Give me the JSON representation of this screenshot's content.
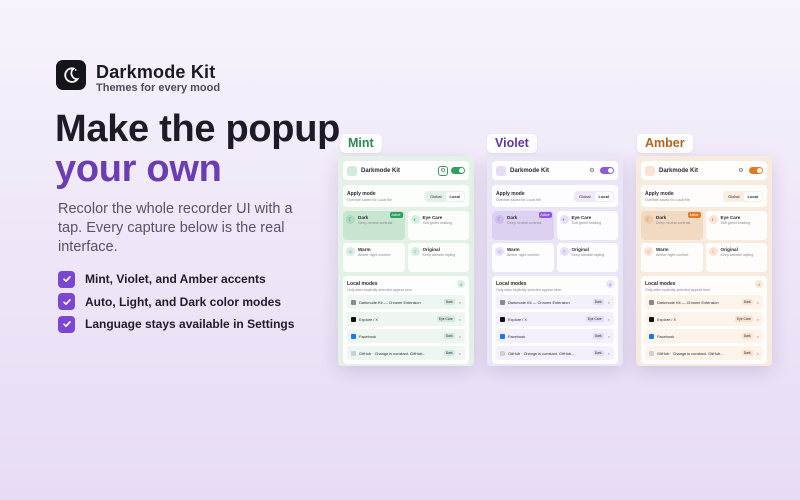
{
  "brand": {
    "name": "Darkmode Kit",
    "tagline": "Themes for every mood"
  },
  "hero": {
    "headline_line1": "Make the popup",
    "headline_line2": "your own",
    "lead": "Recolor the whole recorder UI with a tap. Every capture below is the real interface.",
    "features": [
      "Mint, Violet, and Amber accents",
      "Auto, Light, and Dark color modes",
      "Language stays available in Settings"
    ],
    "accent_color": "#6a3db4",
    "check_color": "#7b47d2"
  },
  "popup": {
    "title": "Darkmode Kit",
    "apply_title": "Apply mode",
    "apply_sub": "Override saved for Local file",
    "segment_global": "Global",
    "segment_local": "Local",
    "tiles": [
      {
        "name": "Dark",
        "desc": "Deep neutral contrast",
        "badge": "Active"
      },
      {
        "name": "Eye Care",
        "desc": "Soft green reading",
        "badge": ""
      },
      {
        "name": "Warm",
        "desc": "Amber night comfort",
        "badge": ""
      },
      {
        "name": "Original",
        "desc": "Keep website styling",
        "badge": ""
      }
    ],
    "local_title": "Local modes",
    "local_sub": "Only sites explicitly selected appear here",
    "local_count": "4",
    "sites": [
      {
        "name": "Darkmode Kit — Chrome Extension",
        "mode": "Dark",
        "remove": "×"
      },
      {
        "name": "Explore / X",
        "mode": "Eye Care",
        "remove": "×"
      },
      {
        "name": "Facebook",
        "mode": "Dark",
        "remove": "×"
      },
      {
        "name": "GitHub · Change is constant. GitHub...",
        "mode": "Dark",
        "remove": "×"
      }
    ]
  },
  "themes": [
    {
      "label": "Mint",
      "accent": "#2f9e5e",
      "bg": "#e3f1e6",
      "label_color": "#2c8a55"
    },
    {
      "label": "Violet",
      "accent": "#8a5cd8",
      "bg": "#ebe6f6",
      "label_color": "#5b3aa0"
    },
    {
      "label": "Amber",
      "accent": "#e07a2a",
      "bg": "#f6ebdd",
      "label_color": "#b06420"
    }
  ]
}
